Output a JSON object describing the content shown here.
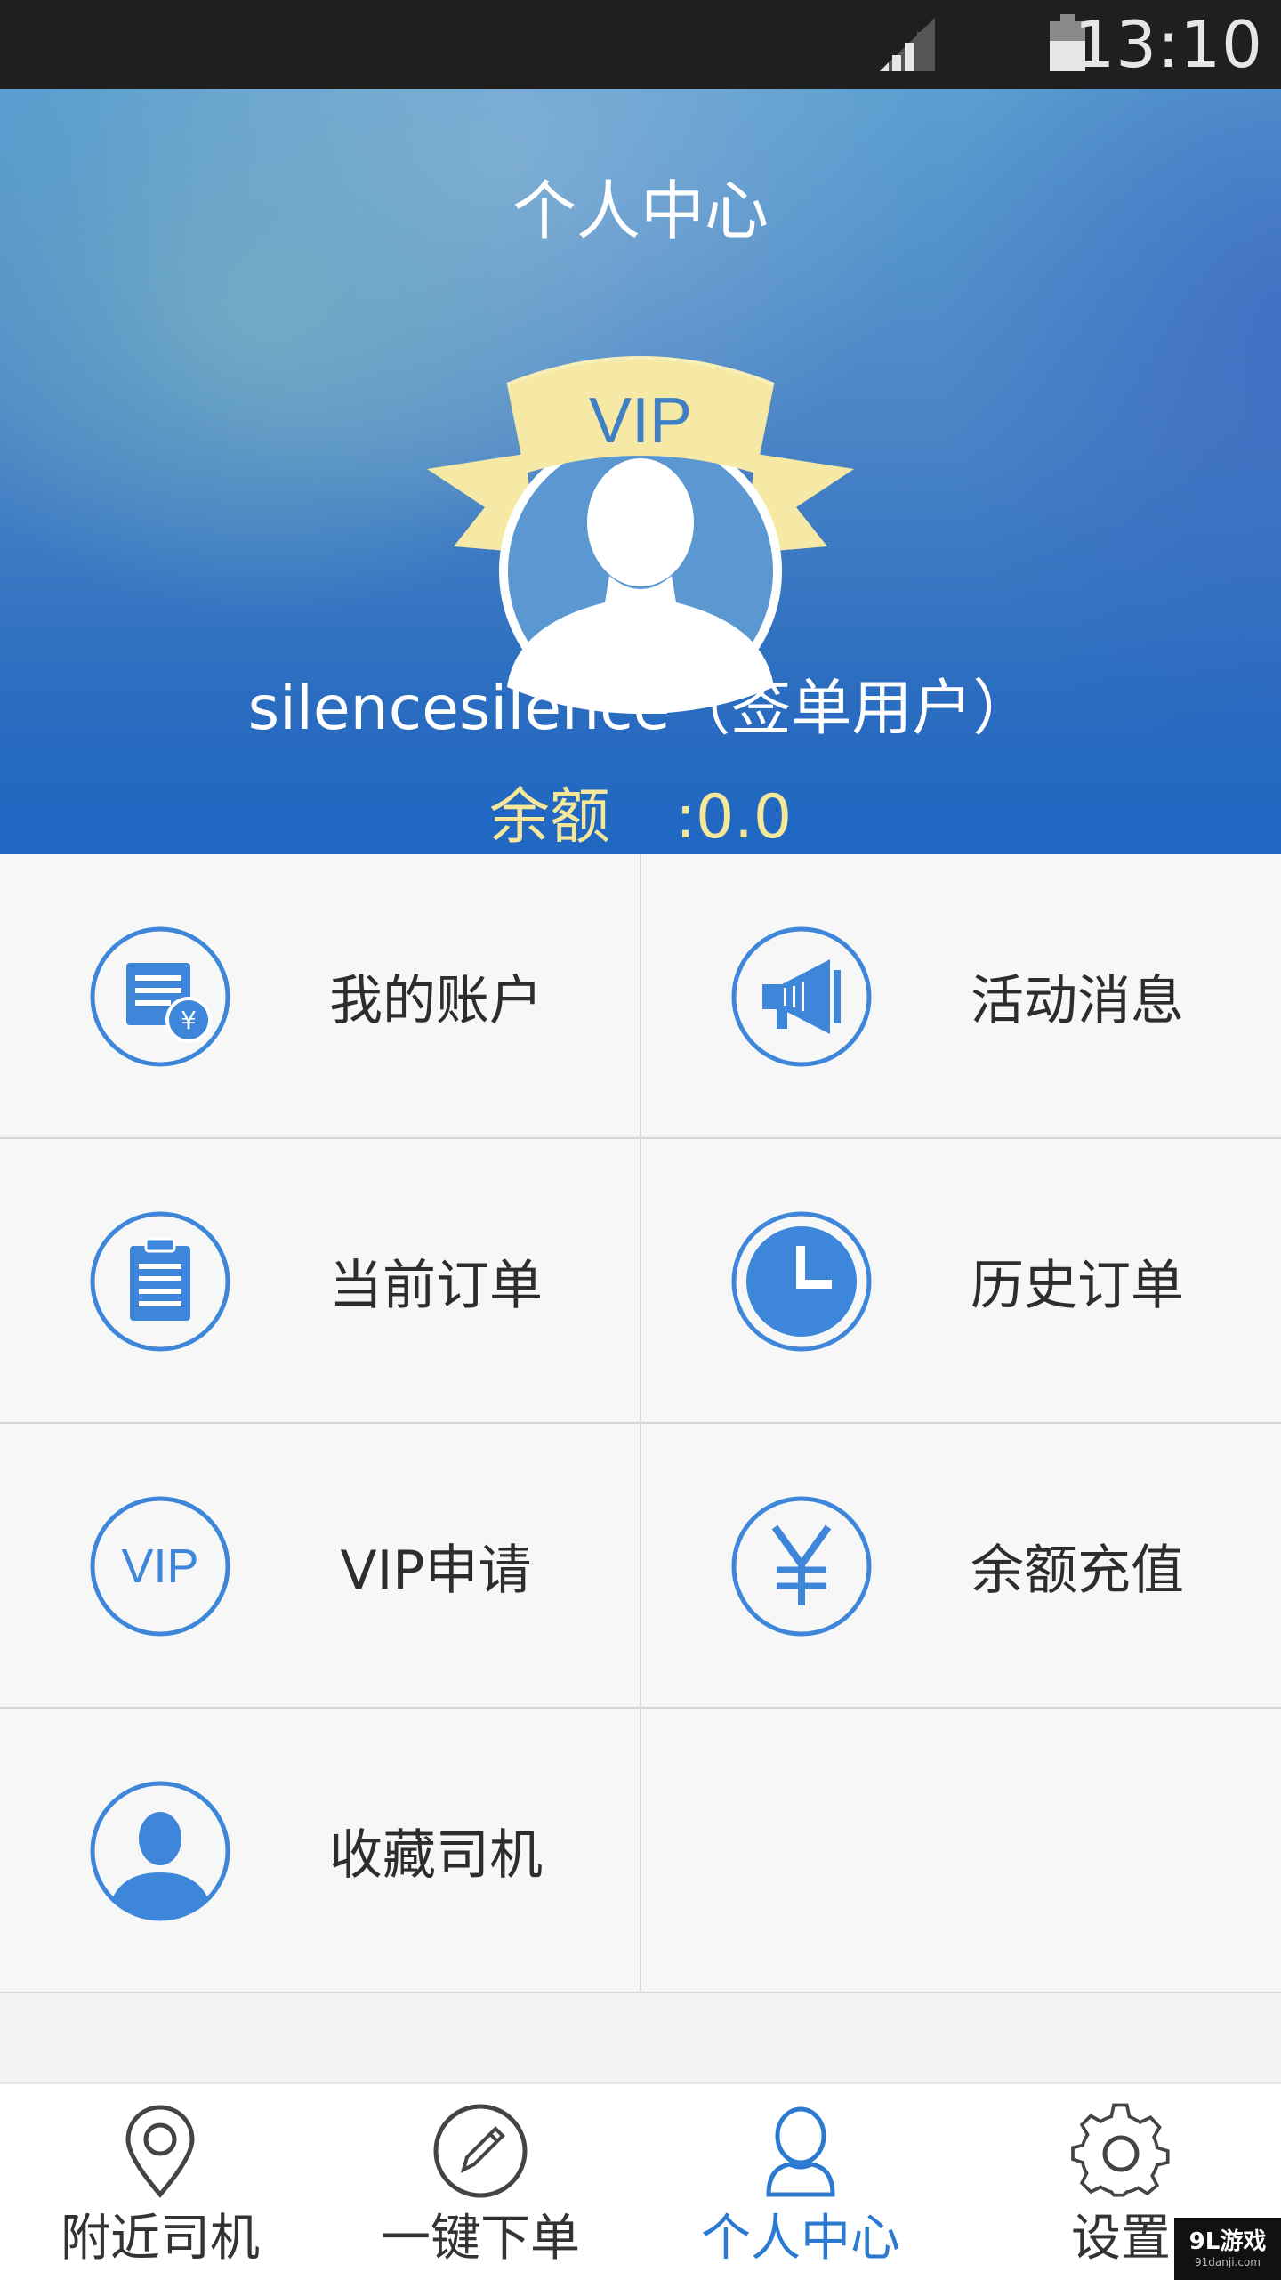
{
  "status_bar": {
    "time": "13:10",
    "signal_icon": "signal-icon",
    "battery_icon": "battery-icon"
  },
  "header": {
    "title": "个人中心",
    "vip_badge": "VIP",
    "username": "silencesilence（签单用户）",
    "balance_label": "余额",
    "balance_value": ":0.0"
  },
  "menu": [
    {
      "label": "我的账户",
      "icon": "account-bill-icon"
    },
    {
      "label": "活动消息",
      "icon": "megaphone-icon"
    },
    {
      "label": "当前订单",
      "icon": "clipboard-list-icon"
    },
    {
      "label": "历史订单",
      "icon": "clock-icon"
    },
    {
      "label": "VIP申请",
      "icon": "vip-icon"
    },
    {
      "label": "余额充值",
      "icon": "yen-icon"
    },
    {
      "label": "收藏司机",
      "icon": "driver-person-icon"
    }
  ],
  "bottom_nav": [
    {
      "label": "附近司机",
      "icon": "location-pin-icon",
      "active": false
    },
    {
      "label": "一键下单",
      "icon": "pencil-circle-icon",
      "active": false
    },
    {
      "label": "个人中心",
      "icon": "person-icon",
      "active": true
    },
    {
      "label": "设置",
      "icon": "gear-icon",
      "active": false
    }
  ],
  "colors": {
    "accent": "#2c79d0",
    "icon_blue": "#3d86da",
    "balance_yellow": "#f5e79a",
    "ribbon_yellow": "#f6e9a6"
  },
  "watermark": {
    "brand": "9L游戏",
    "site": "91danji.com"
  }
}
